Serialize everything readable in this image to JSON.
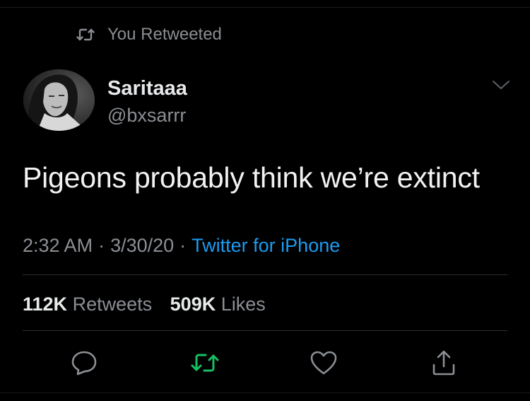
{
  "retweet_context": {
    "label": "You Retweeted",
    "icon": "retweet-icon"
  },
  "author": {
    "display_name": "Saritaaa",
    "handle": "@bxsarrr",
    "avatar_icon": "avatar"
  },
  "tweet": {
    "text": "Pigeons probably think we’re extinct"
  },
  "meta": {
    "time": "2:32 AM",
    "separator": "·",
    "date": "3/30/20",
    "source": "Twitter for iPhone"
  },
  "stats": {
    "retweets_count": "112K",
    "retweets_label": "Retweets",
    "likes_count": "509K",
    "likes_label": "Likes"
  },
  "actions": {
    "reply_icon": "reply-icon",
    "retweet_icon": "retweet-icon",
    "like_icon": "heart-icon",
    "share_icon": "share-icon"
  },
  "colors": {
    "background": "#000000",
    "secondary_text": "#8b8f94",
    "link_blue": "#1d9bf0",
    "retweet_green": "#17bf63",
    "primary_text": "#e7e9ea"
  }
}
